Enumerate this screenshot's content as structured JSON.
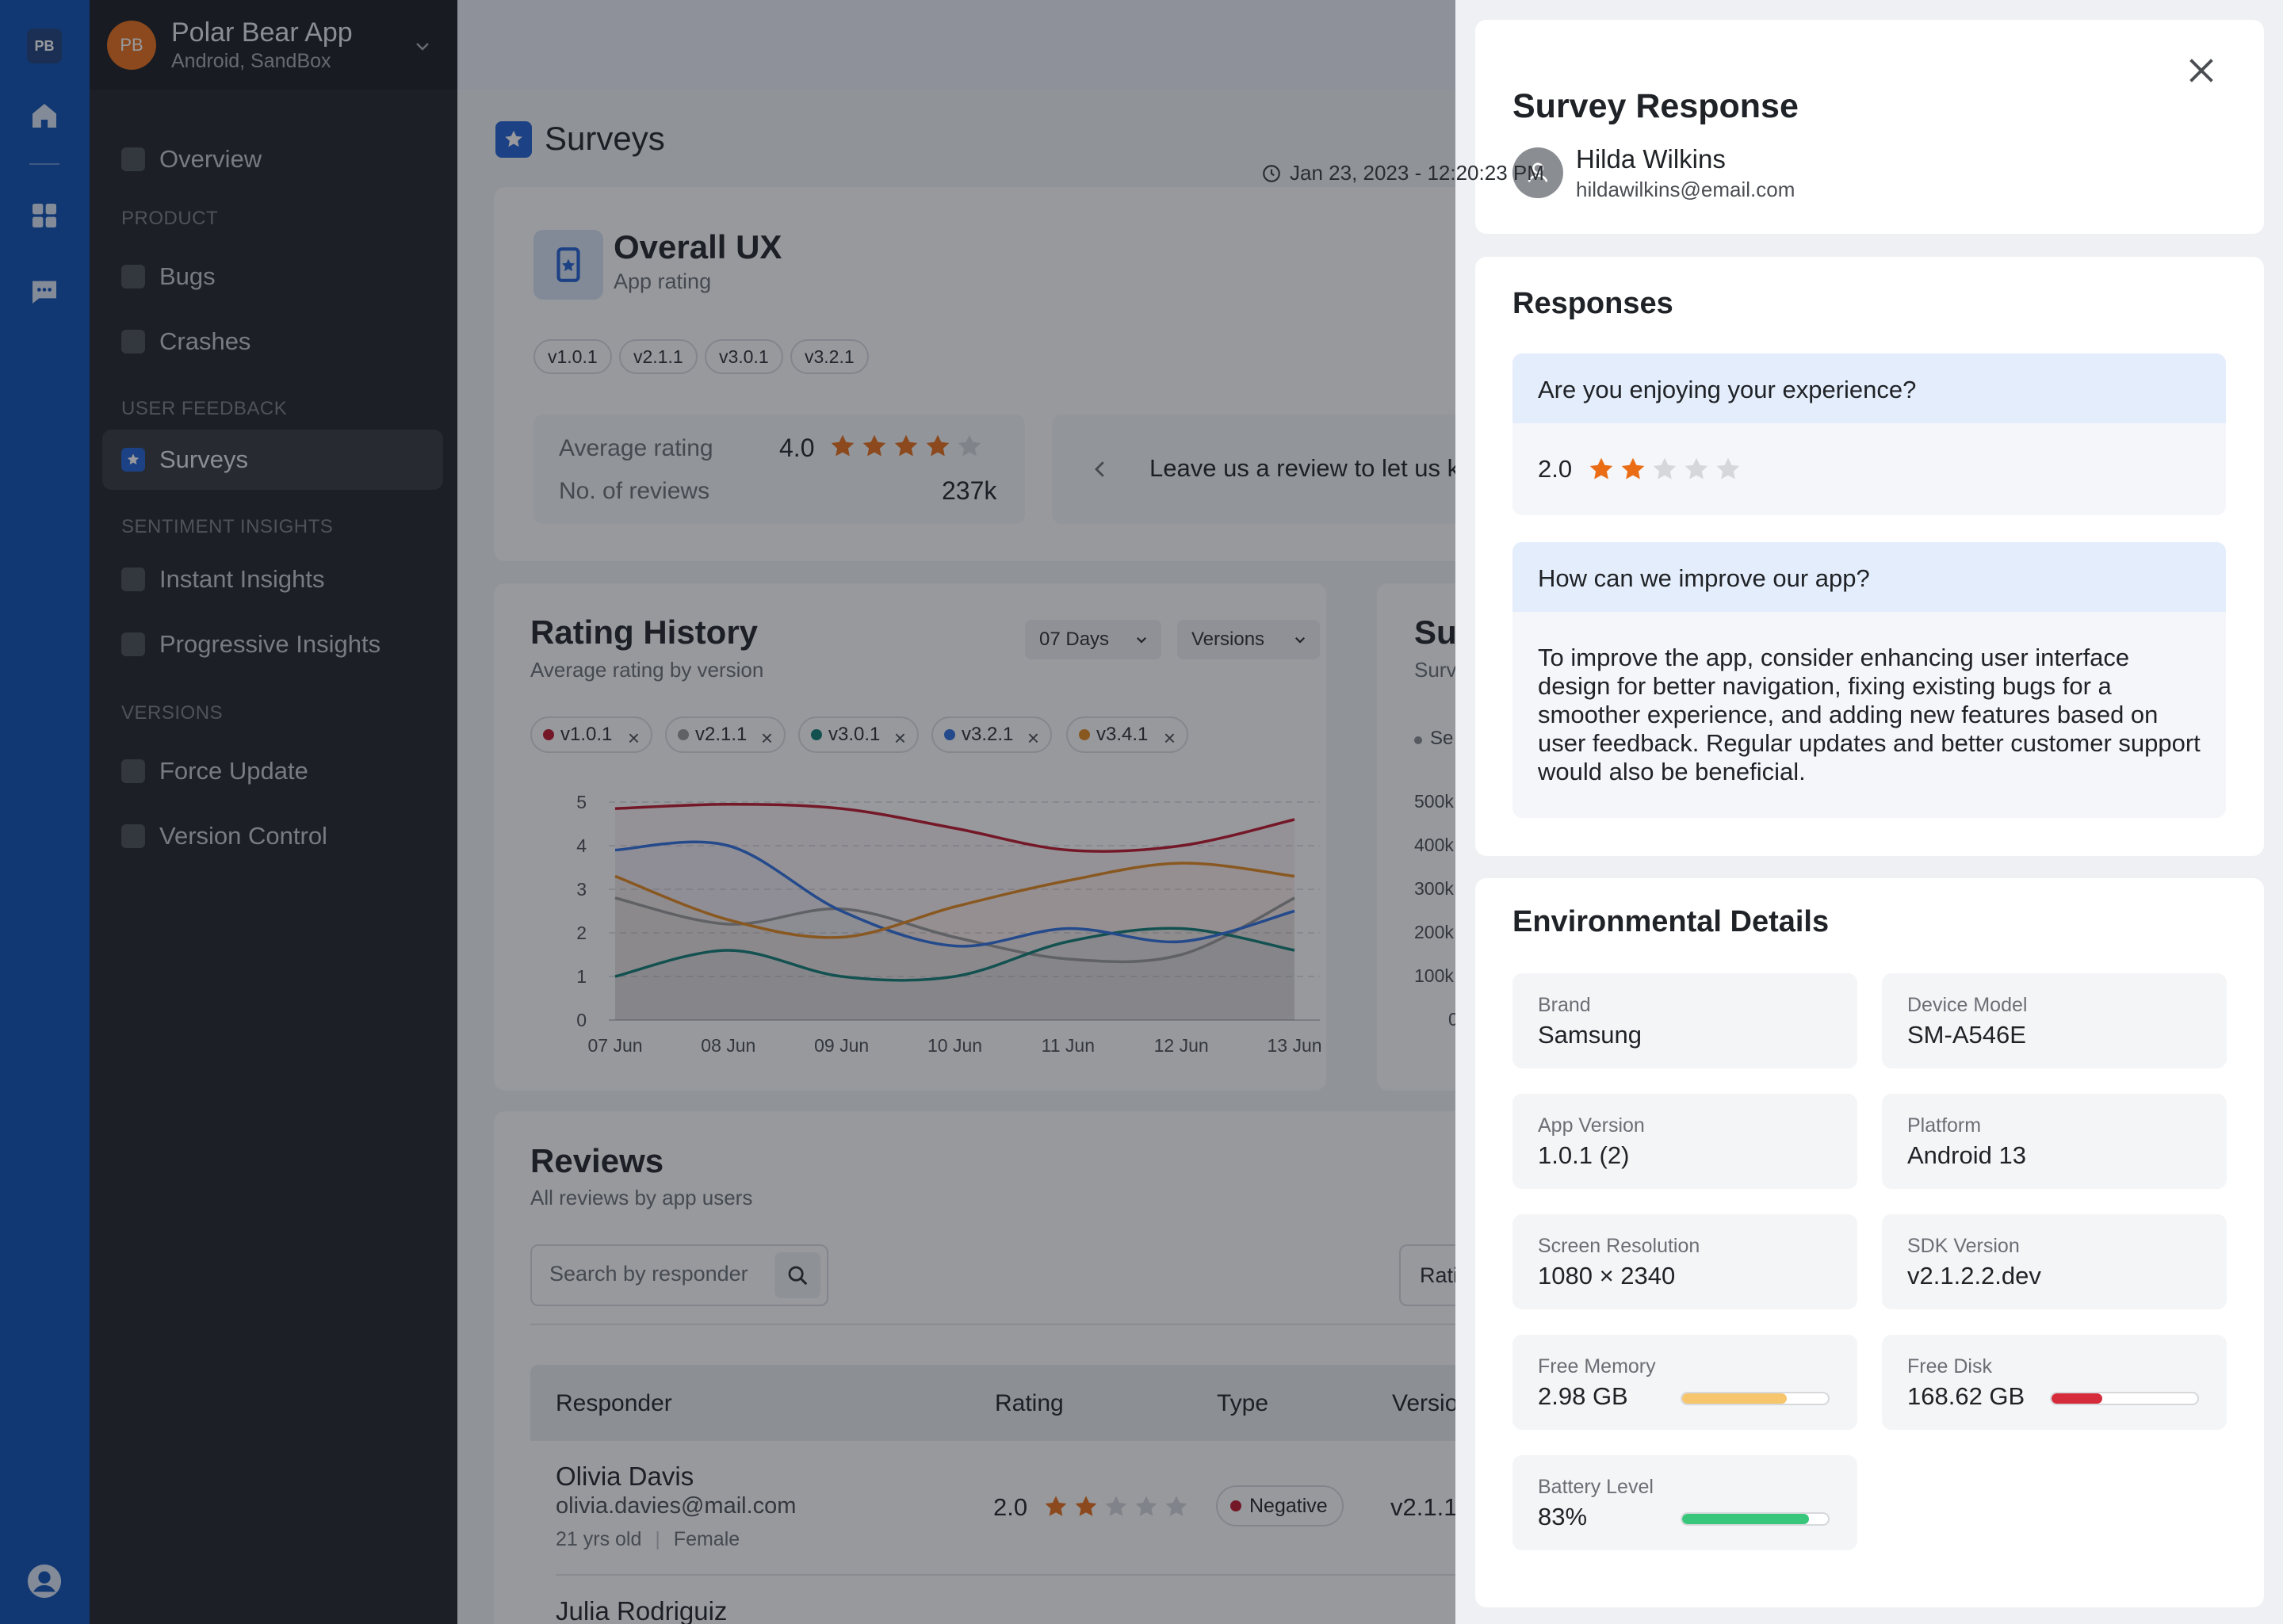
{
  "rail": {
    "logo": "PB",
    "icons": [
      "home-icon",
      "grid-icon",
      "chat-icon",
      "user-icon"
    ]
  },
  "app": {
    "avatar": "PB",
    "name": "Polar Bear App",
    "env": "Android, SandBox"
  },
  "nav": {
    "overview": "Overview",
    "sec_product": "PRODUCT",
    "bugs": "Bugs",
    "crashes": "Crashes",
    "sec_feedback": "USER FEEDBACK",
    "surveys": "Surveys",
    "sec_sentiment": "SENTIMENT INSIGHTS",
    "instant": "Instant Insights",
    "progressive": "Progressive Insights",
    "sec_versions": "VERSIONS",
    "force": "Force Update",
    "version_control": "Version Control"
  },
  "page": {
    "title": "Surveys"
  },
  "ux": {
    "title": "Overall UX",
    "subtitle": "App rating",
    "versions": [
      "v1.0.1",
      "v2.1.1",
      "v3.0.1",
      "v3.2.1"
    ],
    "avg_label": "Average rating",
    "avg_value": "4.0",
    "avg_stars": 4,
    "count_label": "No. of reviews",
    "count_value": "237k",
    "review_text": "Leave us a review to let us k"
  },
  "history": {
    "title": "Rating History",
    "subtitle": "Average rating by version",
    "range": "07 Days",
    "versions_dd": "Versions",
    "chips": [
      {
        "label": "v1.0.1",
        "color": "#c0142a"
      },
      {
        "label": "v2.1.1",
        "color": "#9a9a9a"
      },
      {
        "label": "v3.0.1",
        "color": "#0f7c73"
      },
      {
        "label": "v3.2.1",
        "color": "#2f6fe0"
      },
      {
        "label": "v3.4.1",
        "color": "#e6891e"
      }
    ]
  },
  "side_card": {
    "title": "Su",
    "subtitle": "Surv",
    "legend": "Se",
    "yticks": [
      "500k",
      "400k",
      "300k",
      "200k",
      "100k",
      "0"
    ]
  },
  "chart_data": {
    "type": "line",
    "x": [
      "07 Jun",
      "08 Jun",
      "09 Jun",
      "10 Jun",
      "11 Jun",
      "12 Jun",
      "13 Jun"
    ],
    "ylim": [
      0,
      5
    ],
    "yticks": [
      "5",
      "4",
      "3",
      "2",
      "1",
      "0"
    ],
    "series": [
      {
        "name": "v1.0.1",
        "color": "#c0142a",
        "values": [
          4.85,
          4.95,
          4.85,
          4.4,
          3.9,
          4.0,
          4.6
        ]
      },
      {
        "name": "v2.1.1",
        "color": "#9a9a9a",
        "values": [
          2.8,
          2.2,
          2.55,
          1.9,
          1.4,
          1.5,
          2.8
        ]
      },
      {
        "name": "v3.0.1",
        "color": "#0f7c73",
        "values": [
          1.0,
          1.6,
          1.0,
          1.0,
          1.8,
          2.1,
          1.6
        ]
      },
      {
        "name": "v3.2.1",
        "color": "#2f6fe0",
        "values": [
          3.9,
          4.0,
          2.5,
          1.7,
          2.1,
          1.8,
          2.5
        ]
      },
      {
        "name": "v3.4.1",
        "color": "#e6891e",
        "values": [
          3.3,
          2.3,
          1.9,
          2.6,
          3.2,
          3.6,
          3.3
        ]
      }
    ]
  },
  "reviews": {
    "title": "Reviews",
    "subtitle": "All reviews by app users",
    "search_placeholder": "Search by responder",
    "rating_filter": "Rati",
    "columns": [
      "Responder",
      "Rating",
      "Type",
      "Versio"
    ],
    "rows": [
      {
        "name": "Olivia Davis",
        "email": "olivia.davies@mail.com",
        "age": "21 yrs old",
        "gender": "Female",
        "rating": "2.0",
        "stars": 2,
        "type": "Negative",
        "version": "v2.1.1"
      },
      {
        "name": "Julia Rodriguiz"
      }
    ]
  },
  "drawer": {
    "title": "Survey Response",
    "user_name": "Hilda Wilkins",
    "user_email": "hildawilkins@email.com",
    "timestamp": "Jan 23, 2023 - 12:20:23 PM",
    "responses_title": "Responses",
    "q1": "Are you enjoying your experience?",
    "a1_value": "2.0",
    "a1_stars": 2,
    "q2": "How can we improve our app?",
    "a2": "To improve the app, consider enhancing user interface design for better navigation, fixing existing bugs for a smoother experience, and adding new features based on user feedback. Regular updates and better customer support would also be beneficial.",
    "env_title": "Environmental Details",
    "env": {
      "brand_label": "Brand",
      "brand": "Samsung",
      "model_label": "Device Model",
      "model": "SM-A546E",
      "appver_label": "App Version",
      "appver": "1.0.1 (2)",
      "platform_label": "Platform",
      "platform": "Android 13",
      "res_label": "Screen Resolution",
      "res": "1080 × 2340",
      "sdk_label": "SDK Version",
      "sdk": "v2.1.2.2.dev",
      "mem_label": "Free Memory",
      "mem": "2.98 GB",
      "mem_level": 0.72,
      "mem_color": "#f7c56b",
      "disk_label": "Free Disk",
      "disk": "168.62 GB",
      "disk_level": 0.35,
      "disk_color": "#d62b3a",
      "batt_label": "Battery Level",
      "batt": "83%",
      "batt_level": 0.87,
      "batt_color": "#38c77a"
    }
  }
}
